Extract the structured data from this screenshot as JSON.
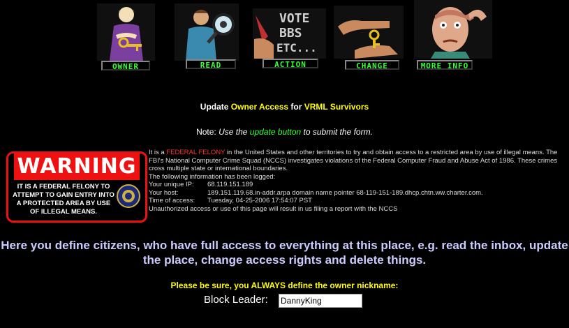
{
  "nav": [
    {
      "label": "OWNER",
      "icon": "woman-holding-key-icon"
    },
    {
      "label": "READ",
      "icon": "man-with-magnifier-icon"
    },
    {
      "label": "ACTION",
      "icon": "vote-bbs-etc-icon"
    },
    {
      "label": "CHANGE",
      "icon": "hand-with-key-icon"
    },
    {
      "label": "MORE INFO",
      "icon": "head-thinking-icon"
    }
  ],
  "vote_sign_text": [
    "VOTE",
    "BBS",
    "ETC..."
  ],
  "title": {
    "prefix": "Update ",
    "highlight1": "Owner Access",
    "mid": " for ",
    "highlight2": "VRML Survivors"
  },
  "note": {
    "prefix": "Note: ",
    "italic1": "Use the ",
    "link": "update button",
    "italic2": " to submit the form."
  },
  "warning": {
    "heading": "WARNING",
    "body": "IT IS A FEDERAL FELONY TO ATTEMPT TO GAIN ENTRY INTO A PROTECTED AREA BY USE OF ILLEGAL MEANS.",
    "seal_icon": "fbi-seal-icon"
  },
  "legal": {
    "p1_a": "It is a ",
    "p1_red": "FEDERAL FELONY",
    "p1_b": " in the United States and other territories to try and obtain access to a restricted area by use of illegal means. The FBI's National Computer Crime Squad (NCCS) investigates violations of the Federal Computer Fraud and Abuse Act of 1986. These crimes cross multiple state or international boundaries.",
    "logged": "The following information has been logged:",
    "ip_label": "Your unique IP:",
    "ip_value": "68.119.151.189",
    "host_label": "Your host:",
    "host_value": "189.151.119.68.in-addr.arpa domain name pointer 68-119-151-189.dhcp.chtn.ww.charter.com.",
    "time_label": "Time of access:",
    "time_value": "Tuesday, 04-25-2006 17:54:07 PST",
    "closing": "Unauthorized access or use of this page will result in us filing a report with the NCCS"
  },
  "define_text": "Here you define citizens, who have full access to everything at this place, e.g. read the inbox, update the place, change access rights and delete things.",
  "sure_text": "Please be sure, you ALWAYS define the owner nickname:",
  "field": {
    "label": "Block Leader",
    "colon": ":",
    "value": "DannyKing"
  },
  "colors": {
    "background": "#000000",
    "accent_yellow": "#ffff00",
    "link_green": "#33ff33",
    "warning_red": "#ee1111",
    "define_text": "#ccccff"
  }
}
